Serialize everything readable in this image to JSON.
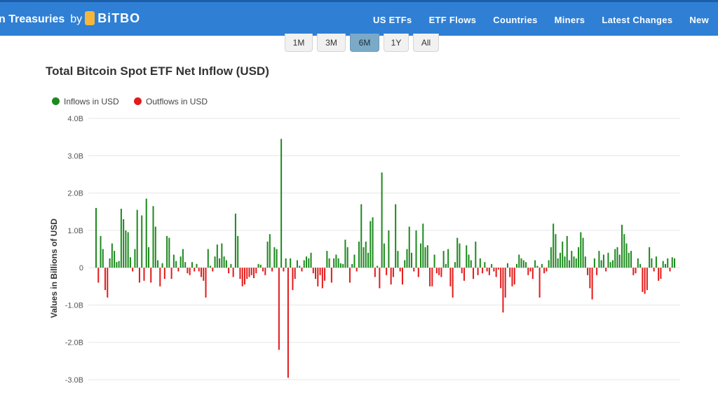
{
  "header": {
    "brand_text": "n Treasuries",
    "by": "by",
    "logo_text": "BiTBO",
    "nav": [
      "US ETFs",
      "ETF Flows",
      "Countries",
      "Miners",
      "Latest Changes",
      "New"
    ]
  },
  "range_buttons": [
    {
      "label": "1M",
      "active": false
    },
    {
      "label": "3M",
      "active": false
    },
    {
      "label": "6M",
      "active": true
    },
    {
      "label": "1Y",
      "active": false
    },
    {
      "label": "All",
      "active": false
    }
  ],
  "colors": {
    "header_bg": "#2f7fd5",
    "inflow": "#1e8a1e",
    "outflow": "#e31b1b",
    "active_button": "#7aaac7"
  },
  "chart_data": {
    "type": "bar",
    "title": "Total Bitcoin Spot ETF Net Inflow (USD)",
    "ylabel": "Values in Billions of USD",
    "xlabel": "",
    "ylim": [
      -3.0,
      4.0
    ],
    "yticks": [
      "4.0B",
      "3.0B",
      "2.0B",
      "1.0B",
      "0",
      "-1.0B",
      "-2.0B",
      "-3.0B"
    ],
    "grid": true,
    "legend_position": "top-left",
    "series": [
      {
        "name": "Inflows in USD",
        "color": "#1e8a1e"
      },
      {
        "name": "Outflows in USD",
        "color": "#e31b1b"
      }
    ],
    "values": [
      1.6,
      -0.4,
      0.85,
      0.5,
      -0.6,
      -0.8,
      0.25,
      0.65,
      0.45,
      0.15,
      0.18,
      1.58,
      1.3,
      1.0,
      0.95,
      0.28,
      -0.1,
      0.5,
      1.55,
      -0.4,
      1.4,
      -0.35,
      1.85,
      0.55,
      -0.4,
      1.65,
      1.1,
      0.2,
      -0.5,
      0.12,
      -0.3,
      0.85,
      0.8,
      -0.3,
      0.35,
      0.18,
      -0.1,
      0.3,
      0.5,
      0.15,
      -0.15,
      -0.2,
      0.15,
      -0.1,
      0.1,
      -0.1,
      -0.25,
      -0.35,
      -0.8,
      0.5,
      0.05,
      -0.1,
      0.3,
      0.62,
      0.25,
      0.65,
      0.3,
      0.2,
      -0.15,
      0.1,
      -0.25,
      1.45,
      0.85,
      -0.3,
      -0.5,
      -0.45,
      -0.3,
      -0.25,
      -0.2,
      -0.28,
      -0.15,
      0.1,
      0.08,
      -0.1,
      -0.2,
      0.7,
      0.9,
      -0.1,
      0.55,
      0.5,
      -2.2,
      3.45,
      -0.1,
      0.25,
      -2.95,
      0.25,
      -0.6,
      -0.3,
      0.2,
      0.05,
      -0.1,
      0.2,
      0.3,
      0.25,
      0.4,
      -0.15,
      -0.3,
      -0.5,
      -0.2,
      -0.55,
      -0.35,
      0.45,
      0.25,
      -0.4,
      0.25,
      0.35,
      0.25,
      0.12,
      0.1,
      0.75,
      0.55,
      -0.4,
      0.1,
      0.35,
      -0.1,
      0.7,
      1.7,
      0.55,
      0.7,
      0.4,
      1.25,
      1.35,
      -0.25,
      0.05,
      -0.55,
      2.55,
      0.65,
      -0.2,
      1.0,
      -0.45,
      -0.25,
      1.7,
      0.45,
      -0.1,
      -0.45,
      0.2,
      0.5,
      1.1,
      0.4,
      -0.1,
      1.0,
      -0.25,
      0.65,
      1.18,
      0.55,
      0.6,
      -0.5,
      -0.5,
      0.35,
      -0.15,
      -0.2,
      -0.25,
      0.45,
      0.1,
      0.5,
      -0.5,
      -0.8,
      0.15,
      0.8,
      0.65,
      -0.15,
      -0.35,
      0.6,
      0.35,
      0.2,
      -0.3,
      0.7,
      -0.2,
      0.25,
      -0.15,
      0.15,
      -0.1,
      -0.2,
      0.1,
      -0.1,
      -0.25,
      -0.05,
      -0.55,
      -1.2,
      -0.8,
      0.12,
      -0.25,
      -0.5,
      -0.45,
      0.1,
      0.35,
      0.25,
      0.2,
      0.15,
      -0.2,
      -0.1,
      -0.3,
      0.2,
      0.05,
      -0.8,
      0.1,
      -0.15,
      -0.1,
      0.2,
      0.55,
      1.18,
      0.9,
      0.25,
      0.4,
      0.7,
      0.3,
      0.85,
      0.2,
      0.45,
      0.3,
      0.25,
      0.55,
      0.95,
      0.8,
      0.3,
      -0.2,
      -0.55,
      -0.85,
      0.25,
      -0.2,
      0.45,
      0.2,
      0.35,
      -0.1,
      0.4,
      0.15,
      0.2,
      0.5,
      0.55,
      0.35,
      1.15,
      0.9,
      0.65,
      0.4,
      0.45,
      -0.2,
      -0.15,
      0.25,
      0.1,
      -0.65,
      -0.7,
      -0.6,
      0.55,
      0.25,
      -0.1,
      0.3,
      -0.35,
      -0.3,
      0.18,
      0.1,
      0.25,
      -0.1,
      0.28,
      0.25
    ]
  }
}
